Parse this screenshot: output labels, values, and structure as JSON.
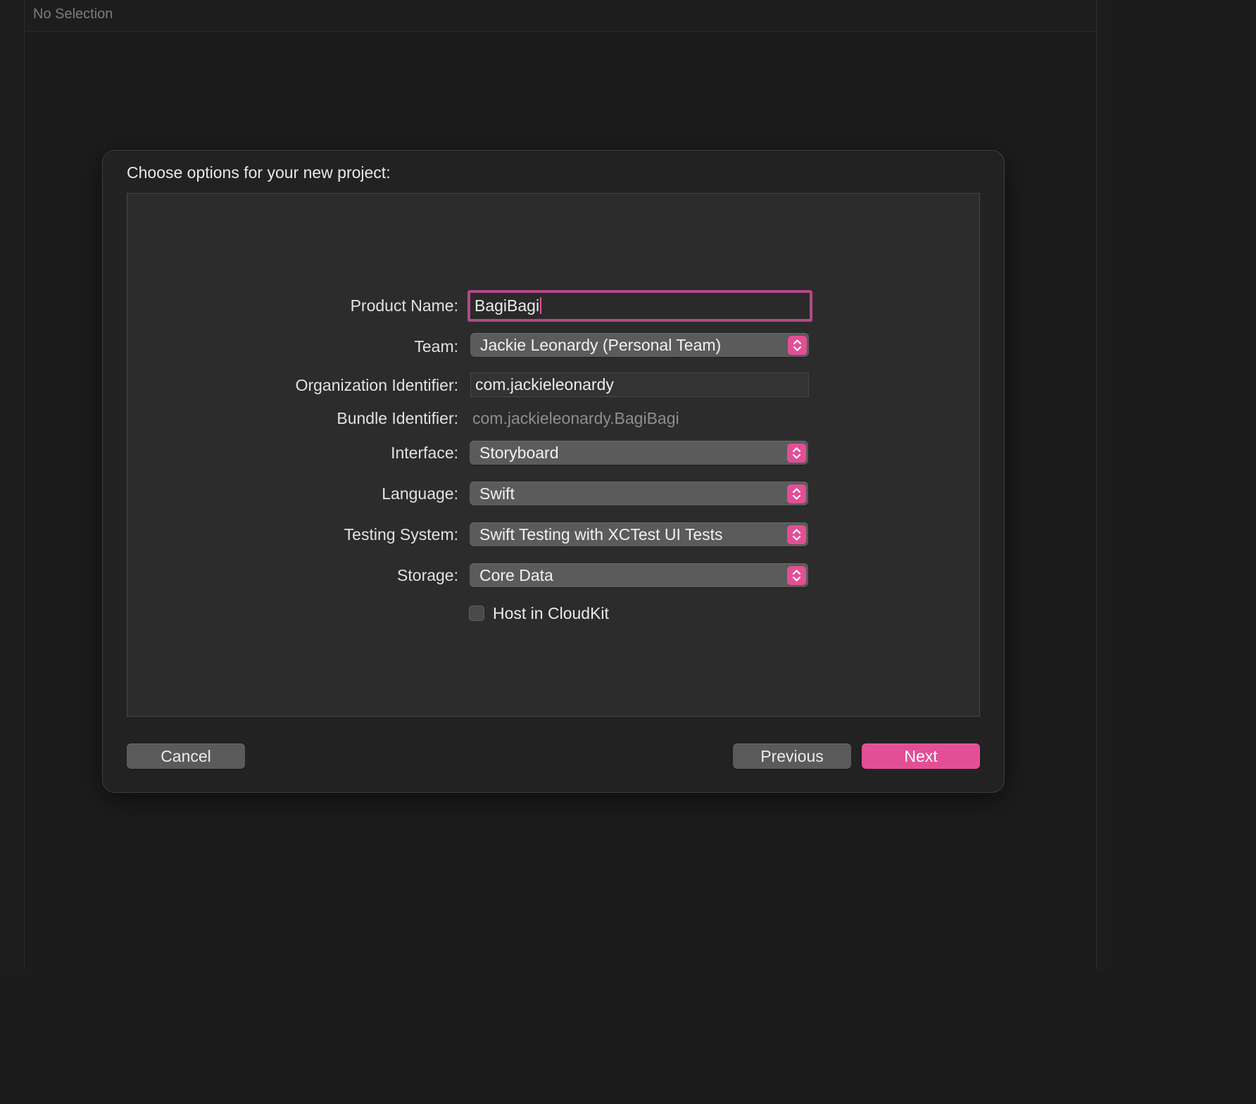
{
  "window": {
    "top_bar_title": "No Selection"
  },
  "sheet": {
    "title": "Choose options for your new project:",
    "fields": {
      "product_name": {
        "label": "Product Name:",
        "value": "BagiBagi"
      },
      "team": {
        "label": "Team:",
        "value": "Jackie Leonardy (Personal Team)"
      },
      "organization_identifier": {
        "label": "Organization Identifier:",
        "value": "com.jackieleonardy"
      },
      "bundle_identifier": {
        "label": "Bundle Identifier:",
        "value": "com.jackieleonardy.BagiBagi"
      },
      "interface": {
        "label": "Interface:",
        "value": "Storyboard"
      },
      "language": {
        "label": "Language:",
        "value": "Swift"
      },
      "testing_system": {
        "label": "Testing System:",
        "value": "Swift Testing with XCTest UI Tests"
      },
      "storage": {
        "label": "Storage:",
        "value": "Core Data"
      }
    },
    "host_in_cloudkit": {
      "label": "Host in CloudKit",
      "checked": false
    },
    "buttons": {
      "cancel": "Cancel",
      "previous": "Previous",
      "next": "Next"
    }
  },
  "colors": {
    "accent": "#e24f95",
    "focus_ring": "#b04a86",
    "background": "#1c1c1c",
    "sheet": "#222222",
    "panel": "#2c2c2c"
  },
  "icons": {
    "popup_stepper": "chevron-up-down-icon"
  }
}
